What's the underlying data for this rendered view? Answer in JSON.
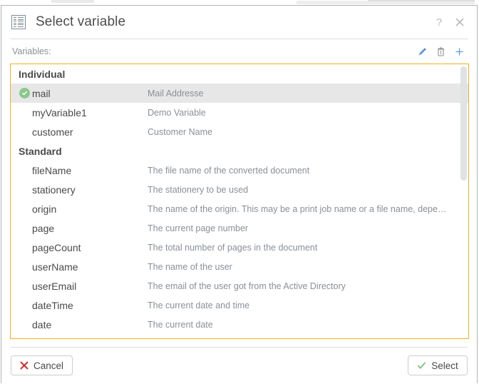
{
  "dialog": {
    "title": "Select variable",
    "title_icon": "list-table-icon",
    "help_label": "?",
    "close_icon": "close-icon"
  },
  "toolbar": {
    "variables_label": "Variables:",
    "edit_icon": "pencil-edit-icon",
    "delete_icon": "trash-delete-icon",
    "add_icon": "plus-add-icon"
  },
  "list": {
    "groups": [
      {
        "header": "Individual",
        "rows": [
          {
            "name": "mail",
            "description": "Mail Addresse",
            "selected": true
          },
          {
            "name": "myVariable1",
            "description": "Demo Variable",
            "selected": false
          },
          {
            "name": "customer",
            "description": "Customer Name",
            "selected": false
          }
        ]
      },
      {
        "header": "Standard",
        "rows": [
          {
            "name": "fileName",
            "description": "The file name of the converted document",
            "selected": false
          },
          {
            "name": "stationery",
            "description": "The stationery to be used",
            "selected": false
          },
          {
            "name": "origin",
            "description": "The name of the origin. This may be a print job name or a file name, depe…",
            "selected": false
          },
          {
            "name": "page",
            "description": "The current page number",
            "selected": false
          },
          {
            "name": "pageCount",
            "description": "The total number of pages in the document",
            "selected": false
          },
          {
            "name": "userName",
            "description": "The name of the user",
            "selected": false
          },
          {
            "name": "userEmail",
            "description": "The email of the user got from the Active Directory",
            "selected": false
          },
          {
            "name": "dateTime",
            "description": "The current date and time",
            "selected": false
          },
          {
            "name": "date",
            "description": "The current date",
            "selected": false
          }
        ]
      }
    ],
    "focus_border_color": "#f2b01e",
    "selected_row_color": "#e7e7e7"
  },
  "footer": {
    "cancel_label": "Cancel",
    "cancel_icon": "red-x-icon",
    "select_label": "Select",
    "select_icon": "green-check-icon"
  },
  "colors": {
    "accent_blue": "#4a90d9",
    "danger_red": "#cc3333",
    "success_green": "#8cc78c",
    "focus_amber": "#f2b01e",
    "text_primary": "#4a4a4a",
    "text_muted": "#8a9096"
  }
}
